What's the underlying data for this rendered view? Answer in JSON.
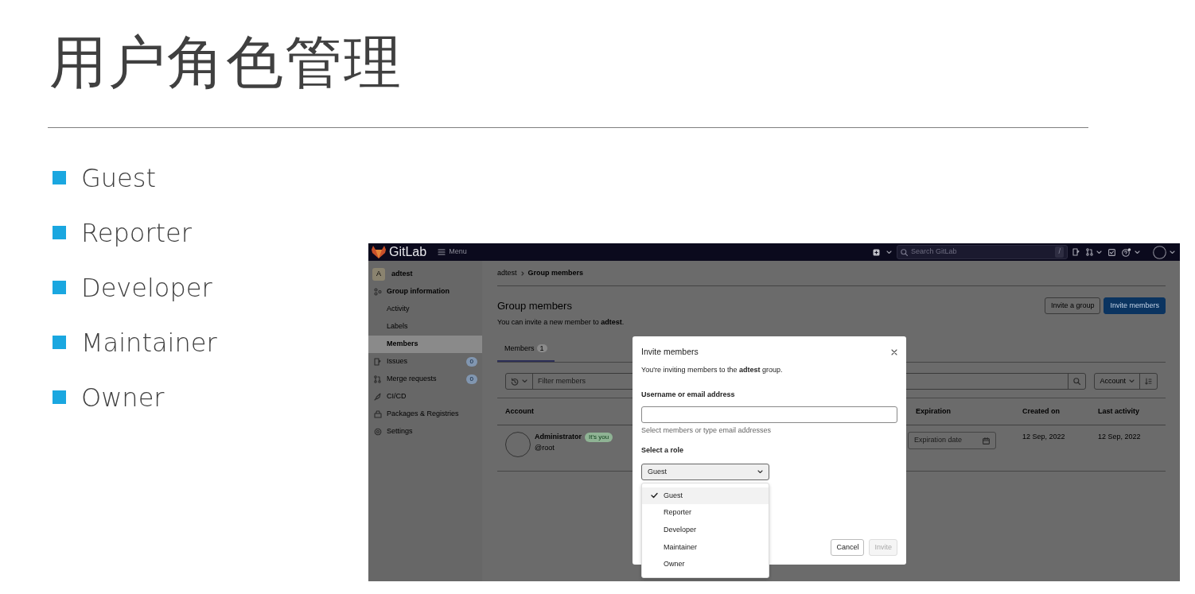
{
  "slide": {
    "title": "用户角色管理",
    "bullets": [
      "Guest",
      "Reporter",
      "Developer",
      "Maintainer",
      "Owner"
    ]
  },
  "screenshot": {
    "topbar": {
      "logo": "GitLab",
      "menu": "Menu",
      "search": {
        "placeholder": "Search GitLab"
      },
      "shortcut": "/"
    },
    "sidebar": {
      "avatar": "A",
      "group": "adtest",
      "items": [
        {
          "label": "Group information",
          "selected": false,
          "children": [
            {
              "label": "Activity",
              "selected": false
            },
            {
              "label": "Labels",
              "selected": false
            },
            {
              "label": "Members",
              "selected": true
            }
          ]
        },
        {
          "label": "Issues",
          "count": "0",
          "selected": false
        },
        {
          "label": "Merge requests",
          "count": "0",
          "selected": false
        },
        {
          "label": "CI/CD",
          "selected": false
        },
        {
          "label": "Packages & Registries",
          "selected": false
        },
        {
          "label": "Settings",
          "selected": false
        }
      ]
    },
    "breadcrumb": [
      "adtest",
      "Group members"
    ],
    "title": "Group members",
    "intro": "You can invite a new member to **adtest**.",
    "buttons": [
      {
        "label": "Invite a group",
        "kind": "secondary"
      },
      {
        "label": "Invite members",
        "kind": "primary"
      }
    ],
    "tabs": [
      {
        "label": "Members",
        "count": "1",
        "selected": true
      }
    ],
    "filter": {
      "placeholder": "Filter members",
      "sort": "Account"
    },
    "table": {
      "columns": [
        "Account",
        "Expiration",
        "Created on",
        "Last activity"
      ],
      "rows": [
        {
          "name": "Administrator",
          "badge": "It's you",
          "username": "@root",
          "expiration": {
            "placeholder": "Expiration date"
          },
          "created": "12 Sep, 2022",
          "last_activity": "12 Sep, 2022"
        }
      ]
    },
    "modal": {
      "title": "Invite members",
      "intro": "You're inviting members to the **adtest** group.",
      "field_label": "Username or email address",
      "field_help": "Select members or type email addresses",
      "role_label": "Select a role",
      "role_value": "Guest",
      "role_options": [
        {
          "label": "Guest",
          "selected": true
        },
        {
          "label": "Reporter",
          "selected": false
        },
        {
          "label": "Developer",
          "selected": false
        },
        {
          "label": "Maintainer",
          "selected": false
        },
        {
          "label": "Owner",
          "selected": false
        }
      ],
      "buttons": [
        {
          "label": "Cancel",
          "disabled": false
        },
        {
          "label": "Invite",
          "disabled": true
        }
      ]
    }
  }
}
